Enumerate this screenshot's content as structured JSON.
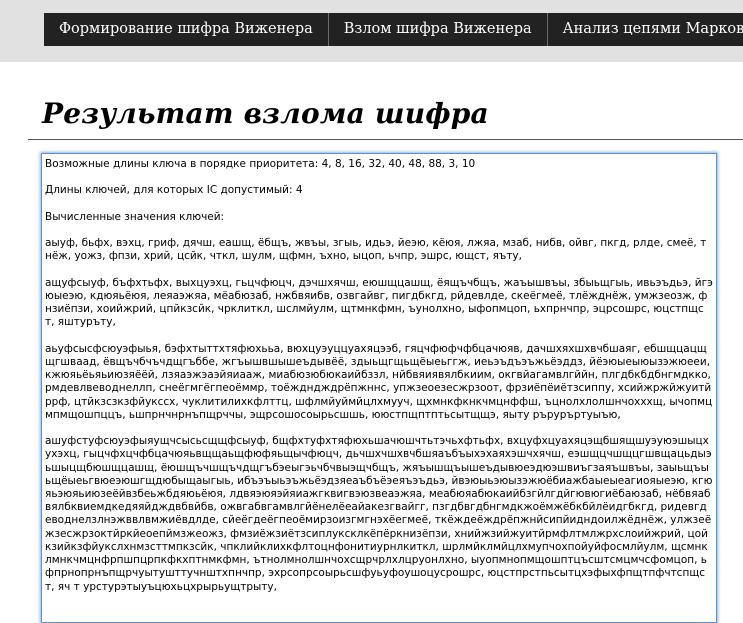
{
  "nav": {
    "items": [
      {
        "label": "Формирование шифра Виженера"
      },
      {
        "label": "Взлом шифра Виженера"
      },
      {
        "label": "Анализ цепями Маркова"
      }
    ]
  },
  "page": {
    "title": "Результат взлома шифра"
  },
  "output": {
    "text": "Возможные длины ключа в порядке приоритета: 4, 8, 16, 32, 40, 48, 88, 3, 10\n\nДлины ключей, для которых IC допустимый: 4\n\nВычисленные значения ключей:\n\nаыуф, бьфх, вэхц, гриф, дячш, еашщ, ёбщъ, жвъы, згыь, идьэ, йеэю, кёюя, лжяа, мзаб, нибв, ойвг, пкгд, рлде, смеё, тнёж, уожз, фпзи, хрий, цсйк, чткл, шулм, щфмн, ъхно, ыцоп, ьчпр, эшрс, ющст, яъту,\n\nащуфсыуф, бъфхтьфх, выхцуэхц, гьцчфюцч, дэчшхячш, еюшщцашщ, ёящъчбщъ, жаъышвъы, збыьщгыь, ивьэъдьэ, йгэюыеэю, кдюяьёюя, леяаэжяа, мёабюзаб, нжбвяибв, озвгайвг, пигдбкгд, рйдевлде, скеёгмеё, тлёжднёж, умжзеозж, фнзиёпзи, хоийжрий, цпйкзсйк, чрклиткл, шслмйулм, щтмнкфмн, ъунолхно, ыфопмцоп, ьхпрнчпр, эцрсошрс, юцстпщст, яштуръту,\n\nаьуфсысфсюуэфыья, бэфхтыттхтяфюхььа, вюхцуэуццуахяцээб, гяцчфюфчфбцачюяв, дачшхяхшхвчбшаяг, ебшщцацщщгшваад, ёвщъчбчъчдщгъббе, жгъышвшышеъдывёё, здыьщгщьщёыеьггж, иеьэъдъэъжьёэддз, йёэюыеыюызэжюееи, кжюяьёьяьиюзяёёй, лзяаэжэаэйяиааж, миабюзюбюкаийбззл, нйбвяиявялбкиим, окгвйагамвлгййн, плгдбкбдбнгмдкко, рмдевлвеводнеллп, снеёгмгёгпеоёммр, тоёждндждрёпжннс, упжзеоезесжрзоот, фрзиёпёиётзсиппу, хсийжржйжуитйррф, цтйкзсзкзфйукссх, чуклитилихкфлттц, шфлмйуймйцлхмууч, щхмнкфкнкчмцнффш, ъцнолхлолшнчохххщ, ычопмцмпмщошпццъ, ьшпрнчнрнъпщрччы, эщрсошосоырьсшшь, ююстпщптптьсытщщэ, яыту ръруръртуыъю,\n\nашуфстуфсюуэфыяущчсысьсщщфсыуф, бщфхтуфхтяфюхьшачюшчтьтэчьхфтьфх, вхцуфхцуахяцэщбшящшуэуюэшыцхухэхц, гыцчфхцчфбцачюяьвщщаьщфюфяьщычфюцч, дьчшхчшхвчбшяаъбъыхэхаяхэшчхячш, еэшщцчшщцгшвщацьдыэьшыцщбюшщцашщ, ёюшщъчшщъчдщгъбэеыгэьчбчвыэщчбщъ, жяъышщъышеъдывюеэдюэшвиъгзаяъшвъы, заыьщъыьщёыеьгвюеэюшгщдюбыщаыгыь, ибъэъыьэъжьёэдзяеаъбъёэеяъэъдьэ, йвэюыьэюызэжюёбиажбаыеыеагиояыеэю, кгюяьэюяьиюзеёйвзбеьжбдяюьёюя, лдвяэюяэйяиажгквигвэюзвеаэжяа, меабюяабюкаийбзгйлгдйгювюгиёбаюзаб, нёбвяабвялбквиемдкедяяйдждвбвйбв, ожвгабвгамвлгйёнелёеайакезгвайгг, пзгдбвгдбнгмдкжоёмжёбкбйлёидгбкгд, ридевгдеводнелзлнэжввлвмжиёвдлде, сйеёгдеёгпеоёмирзоизгмгнэхёегмеё, ткёждеёждрёпжнйсипйидндоилжёднёж, улжзеёжзесжрзоктйркйеоепймзжеожз, фмзиёжзиётзсиплуксклкёпёркнизёпзи, хнийжзийжуитйрмфлтмлжрхслоийжрий, цойкзийкзфйукслхнмзсттмпкзсйк, чпклийклихкфлтоцнфонитиурнлкиткл, шрлмйклмйцлхмупчохпойуйфосмлйулм, щсмнклмнкчмцнфрпшпцрпкфкхптнмкфмн, ътнолмнолшнчохсщрчрлхлцруонлхно, ыуопмнопмщошптцъсштсмцмчсфомцоп, ьфпрнопрнъпщрчуытушттучнштхпнчпр, эхрсопрсоырьсшфуьуфоушоцусрошрс, юцстпрстпьсытцхэфыхфпщтпфчтспщст, яч т урстурэтыуъцюхьцхрырьущтрыту,"
  }
}
